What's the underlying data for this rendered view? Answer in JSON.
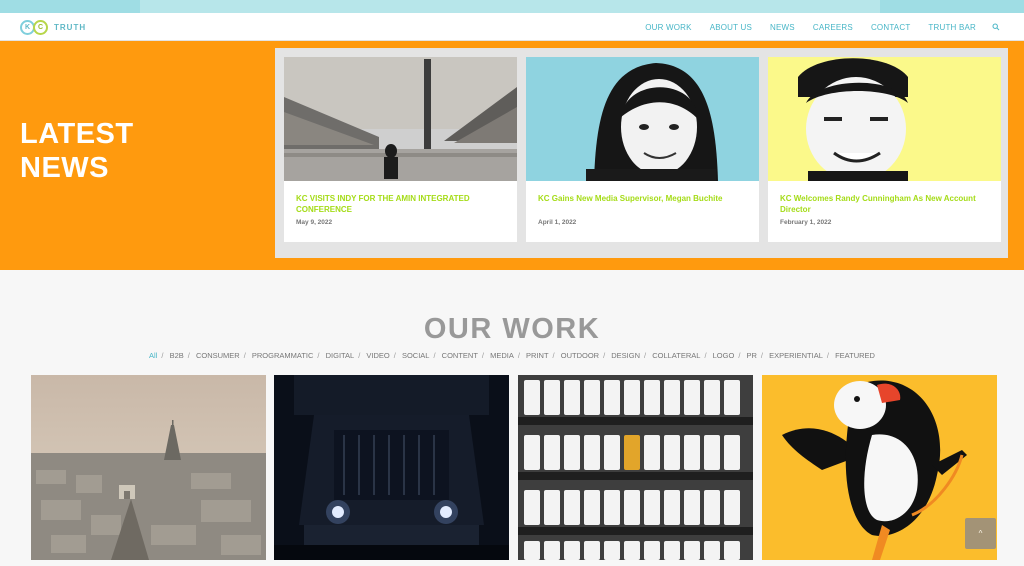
{
  "brand": {
    "logo_letters": [
      "K",
      "C"
    ],
    "name": "TRUTH"
  },
  "nav": [
    "OUR WORK",
    "ABOUT US",
    "NEWS",
    "CAREERS",
    "CONTACT",
    "TRUTH BAR"
  ],
  "latest_news": {
    "title_line1": "LATEST",
    "title_line2": "NEWS",
    "cards": [
      {
        "headline": "KC VISITS INDY FOR THE AMIN INTEGRATED CONFERENCE",
        "date": "May 9, 2022"
      },
      {
        "headline": "KC Gains New Media Supervisor, Megan Buchite",
        "date": "April 1, 2022"
      },
      {
        "headline": "KC Welcomes Randy Cunningham As New Account Director",
        "date": "February 1, 2022"
      }
    ]
  },
  "our_work": {
    "title": "OUR WORK",
    "filters": [
      "All",
      "B2B",
      "CONSUMER",
      "PROGRAMMATIC",
      "DIGITAL",
      "VIDEO",
      "SOCIAL",
      "CONTENT",
      "MEDIA",
      "PRINT",
      "OUTDOOR",
      "DESIGN",
      "COLLATERAL",
      "LOGO",
      "PR",
      "EXPERIENTIAL",
      "FEATURED"
    ]
  },
  "colors": {
    "accent_orange": "#ff9a0e",
    "accent_teal": "#48b6c7",
    "accent_green": "#a5dc18"
  }
}
